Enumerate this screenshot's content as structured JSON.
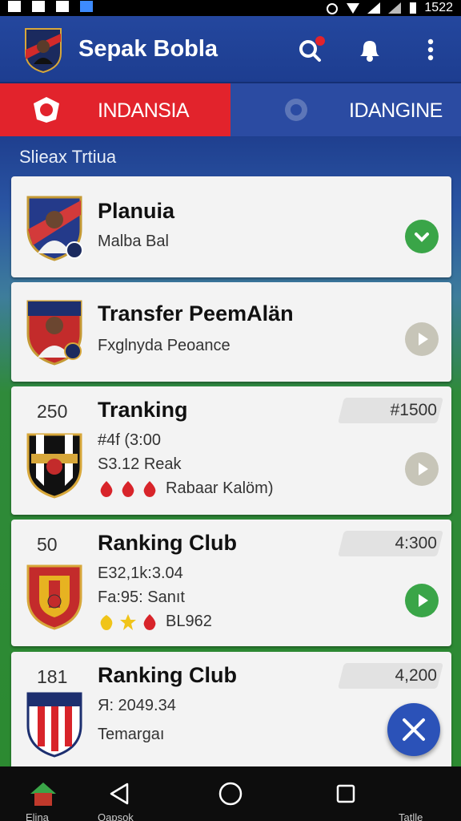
{
  "status": {
    "time": "1522"
  },
  "app": {
    "title": "Sepak Bobla",
    "actions": [
      "search-icon",
      "notification-icon",
      "more-icon"
    ],
    "accent": "#e2232c",
    "brand": "#1d3d90"
  },
  "tabs": [
    {
      "label": "INDANSIA",
      "active": true
    },
    {
      "label": "IDANGINE",
      "active": false
    }
  ],
  "section": {
    "title": "Slieax Trtiua"
  },
  "cards": [
    {
      "title": "Planuia",
      "line1": "Malba Bal",
      "button_color": "#3aa548"
    },
    {
      "title": "Transfer PeemAlän",
      "line1": "Fxglnyda Peoance",
      "button_color": "#c7c5b8"
    },
    {
      "rank": "250",
      "title": "Tranking",
      "score": "#1500",
      "line1": "#4f (3:00",
      "line2": "S3.12 Reak",
      "badges_text": "Rabaar Kalöm)",
      "button_color": "#c7c5b8"
    },
    {
      "rank": "50",
      "title": "Ranking Club",
      "score": "4:300",
      "line1": "Ε32,1k:3.04",
      "line2": "Fa:95: Sanıt",
      "badges_text": "BL962",
      "button_color": "#3aa548"
    },
    {
      "rank": "181",
      "title": "Ranking Club",
      "score": "4,200",
      "line1": "Я: 2049.34",
      "line2": "Temargaı"
    }
  ],
  "nav": {
    "items": [
      {
        "label": "Elina"
      },
      {
        "label": "Qapsok"
      },
      {
        "label": ""
      },
      {
        "label": ""
      },
      {
        "label": "Tatlle"
      }
    ]
  }
}
